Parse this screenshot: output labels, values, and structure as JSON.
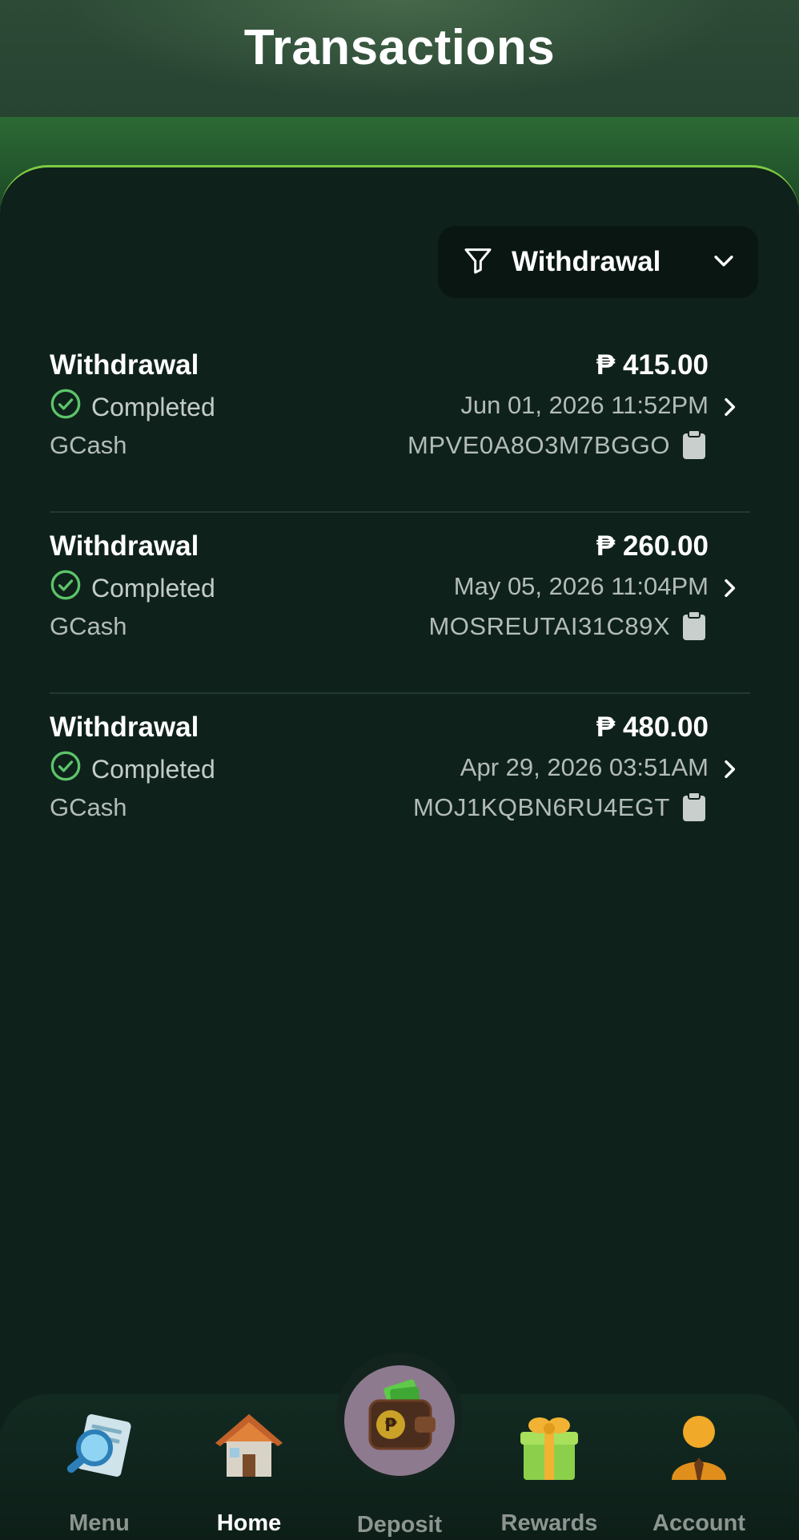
{
  "header": {
    "title": "Transactions"
  },
  "filter": {
    "label": "Withdrawal",
    "icon": "filter-icon"
  },
  "transactions": [
    {
      "type": "Withdrawal",
      "status": "Completed",
      "method": "GCash",
      "amount": "₱ 415.00",
      "datetime": "Jun 01, 2026 11:52PM",
      "reference": "MPVE0A8O3M7BGGO"
    },
    {
      "type": "Withdrawal",
      "status": "Completed",
      "method": "GCash",
      "amount": "₱ 260.00",
      "datetime": "May 05, 2026 11:04PM",
      "reference": "MOSREUTAI31C89X"
    },
    {
      "type": "Withdrawal",
      "status": "Completed",
      "method": "GCash",
      "amount": "₱ 480.00",
      "datetime": "Apr 29, 2026 03:51AM",
      "reference": "MOJ1KQBN6RU4EGT"
    }
  ],
  "colors": {
    "accent": "#7ecb43",
    "status_ok": "#5cc46a",
    "panel": "#0f211b"
  },
  "nav": {
    "items": [
      {
        "label": "Menu",
        "icon": "menu-magnifier-icon"
      },
      {
        "label": "Home",
        "icon": "home-icon",
        "active": true
      },
      {
        "label": "Deposit",
        "icon": "wallet-deposit-icon"
      },
      {
        "label": "Rewards",
        "icon": "gift-icon"
      },
      {
        "label": "Account",
        "icon": "account-icon"
      }
    ]
  }
}
